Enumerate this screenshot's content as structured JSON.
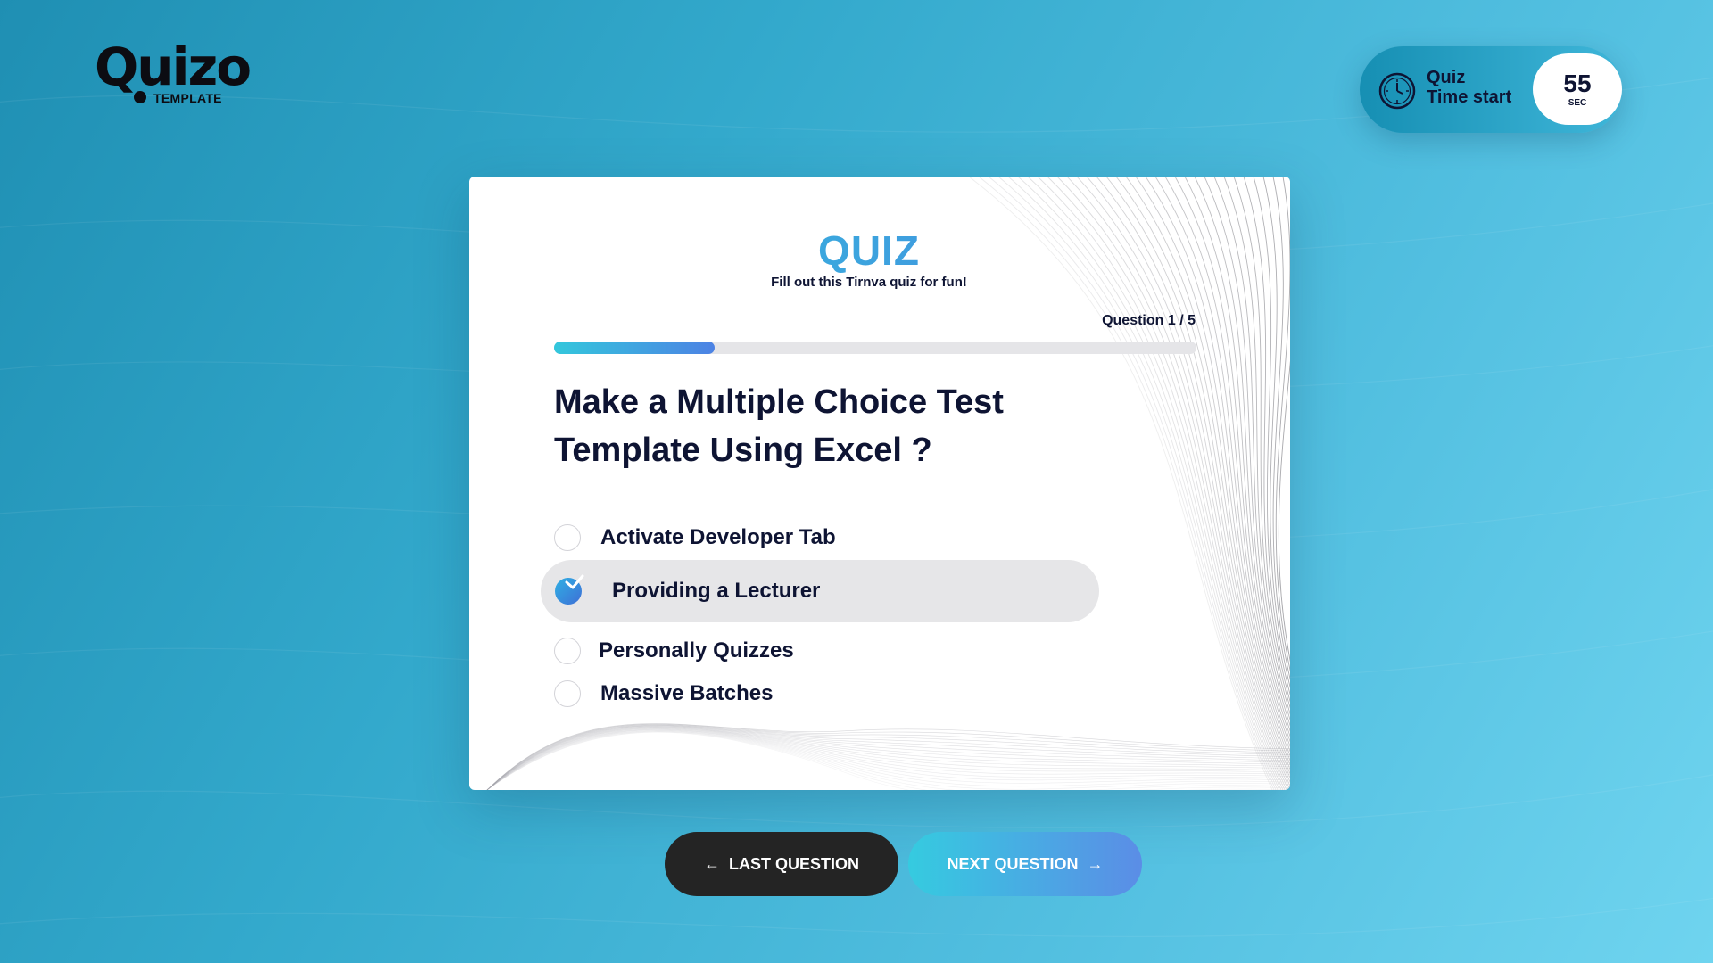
{
  "brand": {
    "logo_text": "Quizo",
    "logo_sub": "TEMPLATE"
  },
  "timer": {
    "label_line1": "Quiz",
    "label_line2": "Time start",
    "count": "55",
    "unit": "SEC",
    "icon": "clock-icon"
  },
  "quiz": {
    "title": "QUIZ",
    "subtitle": "Fill out this Tirnva quiz for fun!",
    "counter": "Question 1 / 5",
    "progress_fraction": 0.25,
    "question_line1": "Make a Multiple Choice Test",
    "question_line2": "Template Using Excel ?",
    "options": [
      {
        "label": "Activate Developer Tab",
        "selected": false
      },
      {
        "label": "Providing a Lecturer",
        "selected": true
      },
      {
        "label": "Personally Quizzes",
        "selected": false
      },
      {
        "label": "Massive Batches",
        "selected": false
      }
    ]
  },
  "nav": {
    "prev_label": "LAST QUESTION",
    "prev_icon": "arrow-left-icon",
    "next_label": "NEXT QUESTION",
    "next_icon": "arrow-right-icon"
  },
  "colors": {
    "accent_cyan": "#33c7dc",
    "accent_blue": "#4d82e4",
    "text_dark": "#0e1433",
    "prev_button": "#242424"
  }
}
